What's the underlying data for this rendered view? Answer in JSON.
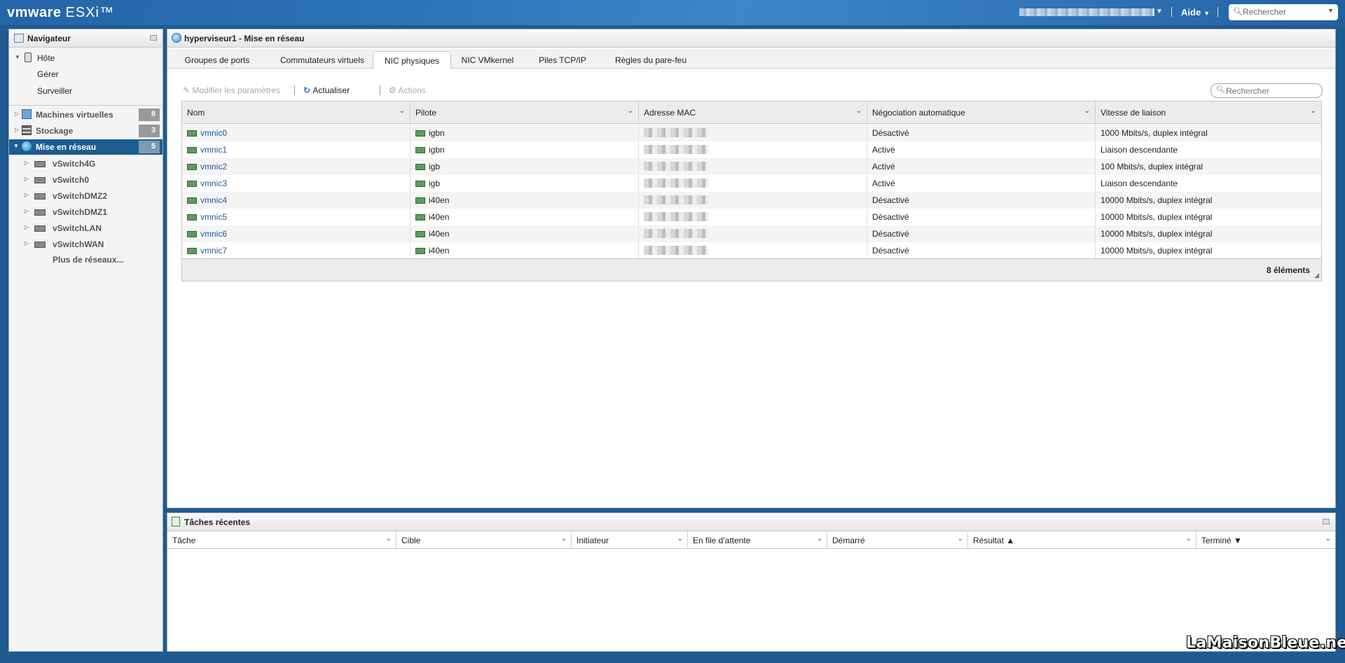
{
  "topbar": {
    "brand": "vmware",
    "product": "ESXi™",
    "help_label": "Aide",
    "search_placeholder": "Rechercher"
  },
  "navigator": {
    "title": "Navigateur",
    "host": "Hôte",
    "host_items": [
      "Gérer",
      "Surveiller"
    ],
    "vms": {
      "label": "Machines virtuelles",
      "count": "8"
    },
    "storage": {
      "label": "Stockage",
      "count": "3"
    },
    "network": {
      "label": "Mise en réseau",
      "count": "5"
    },
    "switches": [
      "vSwitch4G",
      "vSwitch0",
      "vSwitchDMZ2",
      "vSwitchDMZ1",
      "vSwitchLAN",
      "vSwitchWAN"
    ],
    "more": "Plus de réseaux..."
  },
  "main": {
    "title": "hyperviseur1 - Mise en réseau",
    "tabs": [
      "Groupes de ports",
      "Commutateurs virtuels",
      "NIC physiques",
      "NIC VMkernel",
      "Piles TCP/IP",
      "Règles du pare-feu"
    ],
    "active_tab": "NIC physiques",
    "toolbar": {
      "edit": "Modifier les paramètres",
      "refresh": "Actualiser",
      "actions": "Actions",
      "search_placeholder": "Rechercher"
    },
    "table": {
      "columns": [
        "Nom",
        "Pilote",
        "Adresse MAC",
        "Négociation automatique",
        "Vitesse de liaison"
      ],
      "rows": [
        {
          "name": "vmnic0",
          "driver": "igbn",
          "auto": "Désactivé",
          "speed": "1000 Mbits/s, duplex intégral"
        },
        {
          "name": "vmnic1",
          "driver": "igbn",
          "auto": "Activé",
          "speed": "Liaison descendante"
        },
        {
          "name": "vmnic2",
          "driver": "igb",
          "auto": "Activé",
          "speed": "100 Mbits/s, duplex intégral"
        },
        {
          "name": "vmnic3",
          "driver": "igb",
          "auto": "Activé",
          "speed": "Liaison descendante"
        },
        {
          "name": "vmnic4",
          "driver": "i40en",
          "auto": "Désactivé",
          "speed": "10000 Mbits/s, duplex intégral"
        },
        {
          "name": "vmnic5",
          "driver": "i40en",
          "auto": "Désactivé",
          "speed": "10000 Mbits/s, duplex intégral"
        },
        {
          "name": "vmnic6",
          "driver": "i40en",
          "auto": "Désactivé",
          "speed": "10000 Mbits/s, duplex intégral"
        },
        {
          "name": "vmnic7",
          "driver": "i40en",
          "auto": "Désactivé",
          "speed": "10000 Mbits/s, duplex intégral"
        }
      ],
      "count": "8 éléments"
    }
  },
  "tasks": {
    "title": "Tâches récentes",
    "columns": [
      "Tâche",
      "Cible",
      "Initiateur",
      "En file d'attente",
      "Démarré",
      "Résultat ▲",
      "Terminé ▼"
    ]
  },
  "watermark": "LaMaisonBleue.net"
}
